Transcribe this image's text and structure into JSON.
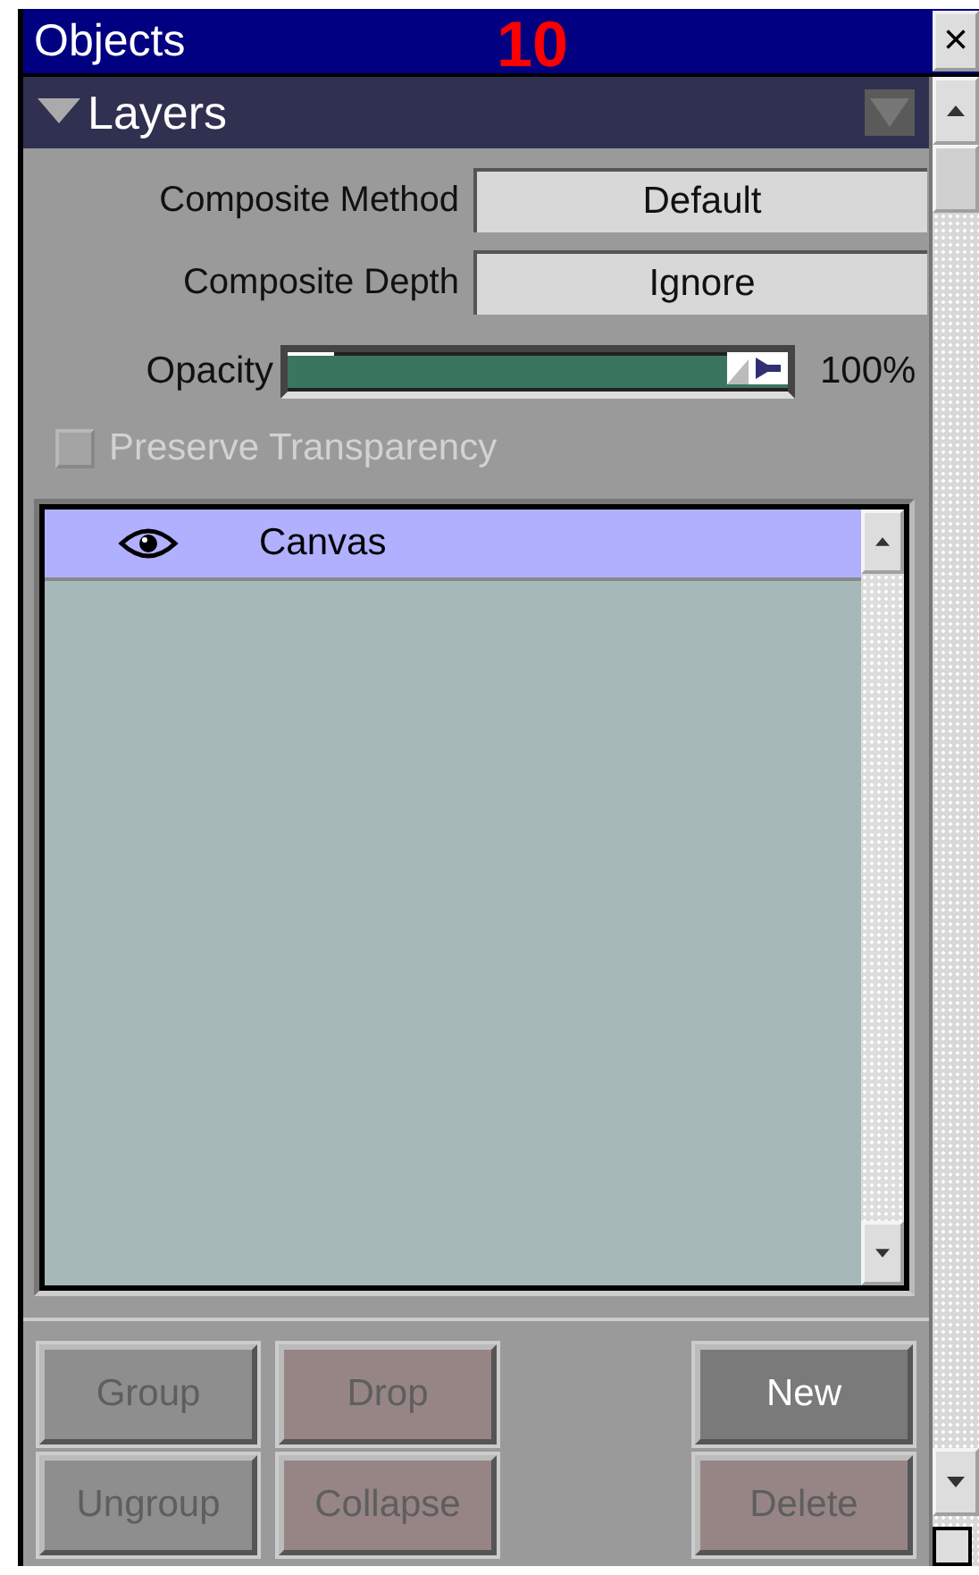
{
  "window": {
    "title": "Objects",
    "badge": "10",
    "close": "×"
  },
  "section": {
    "title": "Layers",
    "expanded": true
  },
  "fields": [
    {
      "label": "Composite Method",
      "value": "Default"
    },
    {
      "label": "Composite Depth",
      "value": "Ignore"
    }
  ],
  "opacity": {
    "label": "Opacity",
    "level": 1,
    "reading": "100%"
  },
  "preserve_transparency": {
    "label": "Preserve Transparency",
    "checked": false,
    "disabled": true
  },
  "layers": [
    {
      "name": "Canvas",
      "visible": true,
      "selected": true
    }
  ],
  "buttons": [
    {
      "label": "Group",
      "disabled": true,
      "color": "#8e8e8e"
    },
    {
      "label": "Drop",
      "disabled": true,
      "color": "#978585"
    },
    {
      "label": "New",
      "disabled": false,
      "color": "#7a7a7a"
    },
    {
      "label": "Ungroup",
      "disabled": true,
      "color": "#8e8e8e"
    },
    {
      "label": "Collapse",
      "disabled": true,
      "color": "#978585"
    },
    {
      "label": "Delete",
      "disabled": true,
      "color": "#978585"
    }
  ]
}
